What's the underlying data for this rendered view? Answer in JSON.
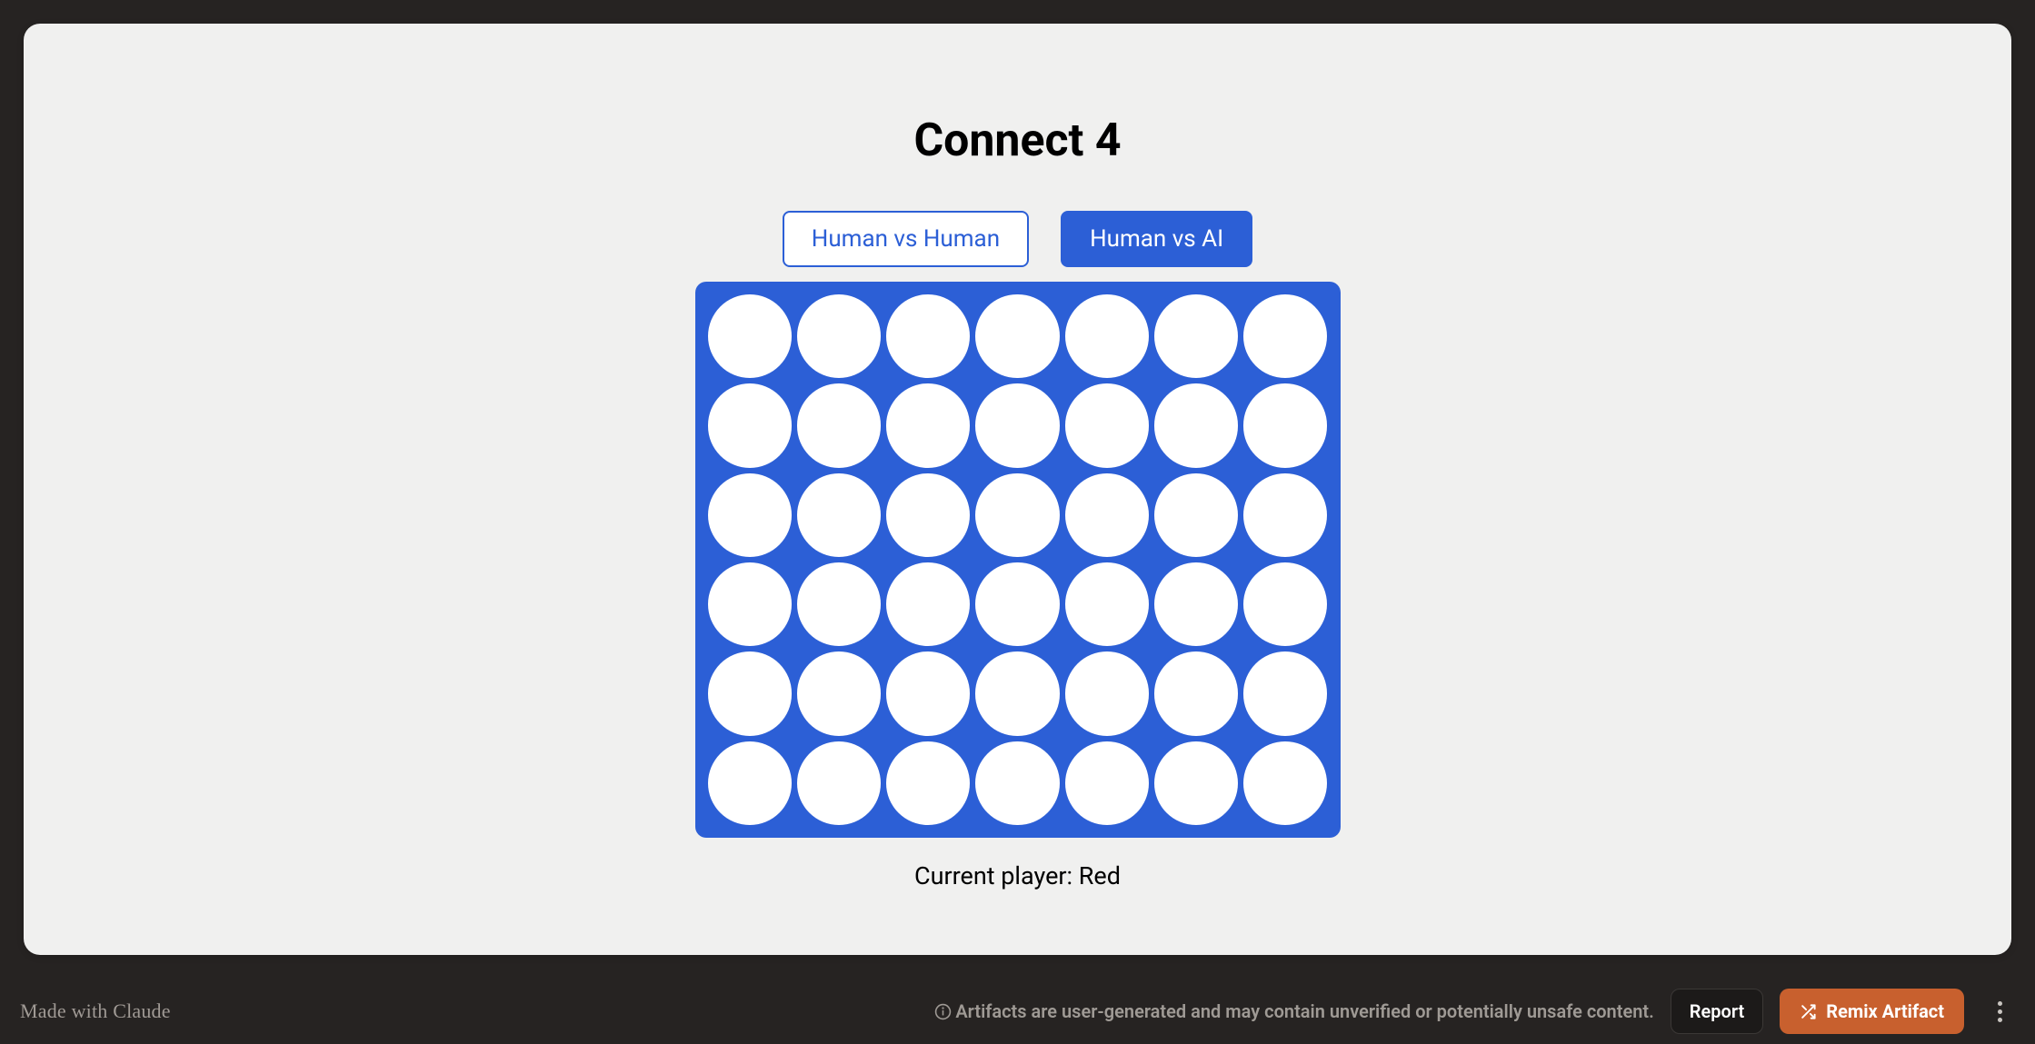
{
  "title": "Connect 4",
  "modes": {
    "human_vs_human": "Human vs Human",
    "human_vs_ai": "Human vs AI",
    "active": "human_vs_ai"
  },
  "board": {
    "rows": 6,
    "cols": 7,
    "cells": [
      [
        "empty",
        "empty",
        "empty",
        "empty",
        "empty",
        "empty",
        "empty"
      ],
      [
        "empty",
        "empty",
        "empty",
        "empty",
        "empty",
        "empty",
        "empty"
      ],
      [
        "empty",
        "empty",
        "empty",
        "empty",
        "empty",
        "empty",
        "empty"
      ],
      [
        "empty",
        "empty",
        "empty",
        "empty",
        "empty",
        "empty",
        "empty"
      ],
      [
        "empty",
        "empty",
        "empty",
        "empty",
        "empty",
        "empty",
        "empty"
      ],
      [
        "empty",
        "empty",
        "empty",
        "empty",
        "empty",
        "empty",
        "empty"
      ]
    ]
  },
  "status": {
    "prefix": "Current player: ",
    "player": "Red"
  },
  "footer": {
    "made_with": "Made with Claude",
    "disclaimer": "Artifacts are user-generated and may contain unverified or potentially unsafe content.",
    "report_label": "Report",
    "remix_label": "Remix Artifact"
  },
  "colors": {
    "board_blue": "#2c5fd6",
    "empty_cell": "#ffffff",
    "remix_orange": "#c8602e",
    "page_bg": "#f0f0ef",
    "frame_bg": "#262322"
  }
}
